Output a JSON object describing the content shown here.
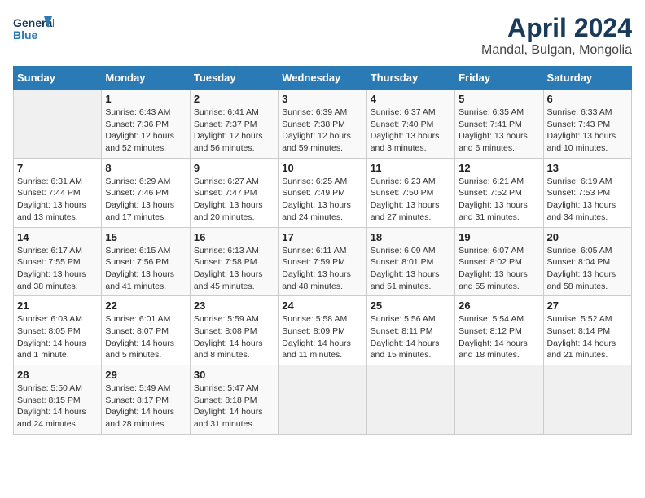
{
  "header": {
    "logo_line1": "General",
    "logo_line2": "Blue",
    "title": "April 2024",
    "subtitle": "Mandal, Bulgan, Mongolia"
  },
  "calendar": {
    "days_of_week": [
      "Sunday",
      "Monday",
      "Tuesday",
      "Wednesday",
      "Thursday",
      "Friday",
      "Saturday"
    ],
    "weeks": [
      [
        {
          "day": "",
          "info": ""
        },
        {
          "day": "1",
          "info": "Sunrise: 6:43 AM\nSunset: 7:36 PM\nDaylight: 12 hours\nand 52 minutes."
        },
        {
          "day": "2",
          "info": "Sunrise: 6:41 AM\nSunset: 7:37 PM\nDaylight: 12 hours\nand 56 minutes."
        },
        {
          "day": "3",
          "info": "Sunrise: 6:39 AM\nSunset: 7:38 PM\nDaylight: 12 hours\nand 59 minutes."
        },
        {
          "day": "4",
          "info": "Sunrise: 6:37 AM\nSunset: 7:40 PM\nDaylight: 13 hours\nand 3 minutes."
        },
        {
          "day": "5",
          "info": "Sunrise: 6:35 AM\nSunset: 7:41 PM\nDaylight: 13 hours\nand 6 minutes."
        },
        {
          "day": "6",
          "info": "Sunrise: 6:33 AM\nSunset: 7:43 PM\nDaylight: 13 hours\nand 10 minutes."
        }
      ],
      [
        {
          "day": "7",
          "info": "Sunrise: 6:31 AM\nSunset: 7:44 PM\nDaylight: 13 hours\nand 13 minutes."
        },
        {
          "day": "8",
          "info": "Sunrise: 6:29 AM\nSunset: 7:46 PM\nDaylight: 13 hours\nand 17 minutes."
        },
        {
          "day": "9",
          "info": "Sunrise: 6:27 AM\nSunset: 7:47 PM\nDaylight: 13 hours\nand 20 minutes."
        },
        {
          "day": "10",
          "info": "Sunrise: 6:25 AM\nSunset: 7:49 PM\nDaylight: 13 hours\nand 24 minutes."
        },
        {
          "day": "11",
          "info": "Sunrise: 6:23 AM\nSunset: 7:50 PM\nDaylight: 13 hours\nand 27 minutes."
        },
        {
          "day": "12",
          "info": "Sunrise: 6:21 AM\nSunset: 7:52 PM\nDaylight: 13 hours\nand 31 minutes."
        },
        {
          "day": "13",
          "info": "Sunrise: 6:19 AM\nSunset: 7:53 PM\nDaylight: 13 hours\nand 34 minutes."
        }
      ],
      [
        {
          "day": "14",
          "info": "Sunrise: 6:17 AM\nSunset: 7:55 PM\nDaylight: 13 hours\nand 38 minutes."
        },
        {
          "day": "15",
          "info": "Sunrise: 6:15 AM\nSunset: 7:56 PM\nDaylight: 13 hours\nand 41 minutes."
        },
        {
          "day": "16",
          "info": "Sunrise: 6:13 AM\nSunset: 7:58 PM\nDaylight: 13 hours\nand 45 minutes."
        },
        {
          "day": "17",
          "info": "Sunrise: 6:11 AM\nSunset: 7:59 PM\nDaylight: 13 hours\nand 48 minutes."
        },
        {
          "day": "18",
          "info": "Sunrise: 6:09 AM\nSunset: 8:01 PM\nDaylight: 13 hours\nand 51 minutes."
        },
        {
          "day": "19",
          "info": "Sunrise: 6:07 AM\nSunset: 8:02 PM\nDaylight: 13 hours\nand 55 minutes."
        },
        {
          "day": "20",
          "info": "Sunrise: 6:05 AM\nSunset: 8:04 PM\nDaylight: 13 hours\nand 58 minutes."
        }
      ],
      [
        {
          "day": "21",
          "info": "Sunrise: 6:03 AM\nSunset: 8:05 PM\nDaylight: 14 hours\nand 1 minute."
        },
        {
          "day": "22",
          "info": "Sunrise: 6:01 AM\nSunset: 8:07 PM\nDaylight: 14 hours\nand 5 minutes."
        },
        {
          "day": "23",
          "info": "Sunrise: 5:59 AM\nSunset: 8:08 PM\nDaylight: 14 hours\nand 8 minutes."
        },
        {
          "day": "24",
          "info": "Sunrise: 5:58 AM\nSunset: 8:09 PM\nDaylight: 14 hours\nand 11 minutes."
        },
        {
          "day": "25",
          "info": "Sunrise: 5:56 AM\nSunset: 8:11 PM\nDaylight: 14 hours\nand 15 minutes."
        },
        {
          "day": "26",
          "info": "Sunrise: 5:54 AM\nSunset: 8:12 PM\nDaylight: 14 hours\nand 18 minutes."
        },
        {
          "day": "27",
          "info": "Sunrise: 5:52 AM\nSunset: 8:14 PM\nDaylight: 14 hours\nand 21 minutes."
        }
      ],
      [
        {
          "day": "28",
          "info": "Sunrise: 5:50 AM\nSunset: 8:15 PM\nDaylight: 14 hours\nand 24 minutes."
        },
        {
          "day": "29",
          "info": "Sunrise: 5:49 AM\nSunset: 8:17 PM\nDaylight: 14 hours\nand 28 minutes."
        },
        {
          "day": "30",
          "info": "Sunrise: 5:47 AM\nSunset: 8:18 PM\nDaylight: 14 hours\nand 31 minutes."
        },
        {
          "day": "",
          "info": ""
        },
        {
          "day": "",
          "info": ""
        },
        {
          "day": "",
          "info": ""
        },
        {
          "day": "",
          "info": ""
        }
      ]
    ]
  }
}
